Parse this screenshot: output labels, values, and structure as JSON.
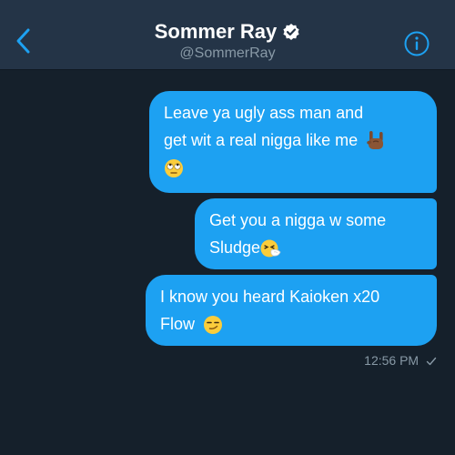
{
  "header": {
    "title": "Sommer Ray",
    "handle": "@SommerRay",
    "back_icon": "chevron-left-icon",
    "verified_icon": "verified-badge-icon",
    "info_icon": "info-icon"
  },
  "messages": [
    {
      "lines": [
        "Leave ya ugly ass man and",
        "get wit a real nigga like me"
      ],
      "emoji": [
        "sign-of-the-horns-emoji",
        "rolling-eyes-emoji"
      ]
    },
    {
      "lines": [
        "Get you a nigga w some",
        "Sludge"
      ],
      "emoji": [
        "sneezing-face-emoji"
      ]
    },
    {
      "lines": [
        "I know you heard Kaioken x20",
        "Flow"
      ],
      "emoji": [
        "smirking-face-emoji"
      ]
    }
  ],
  "status": {
    "time": "12:56 PM",
    "read_icon": "check-icon"
  },
  "colors": {
    "background": "#15202b",
    "header": "#243447",
    "accent": "#1da1f2",
    "muted": "#8899a6"
  }
}
